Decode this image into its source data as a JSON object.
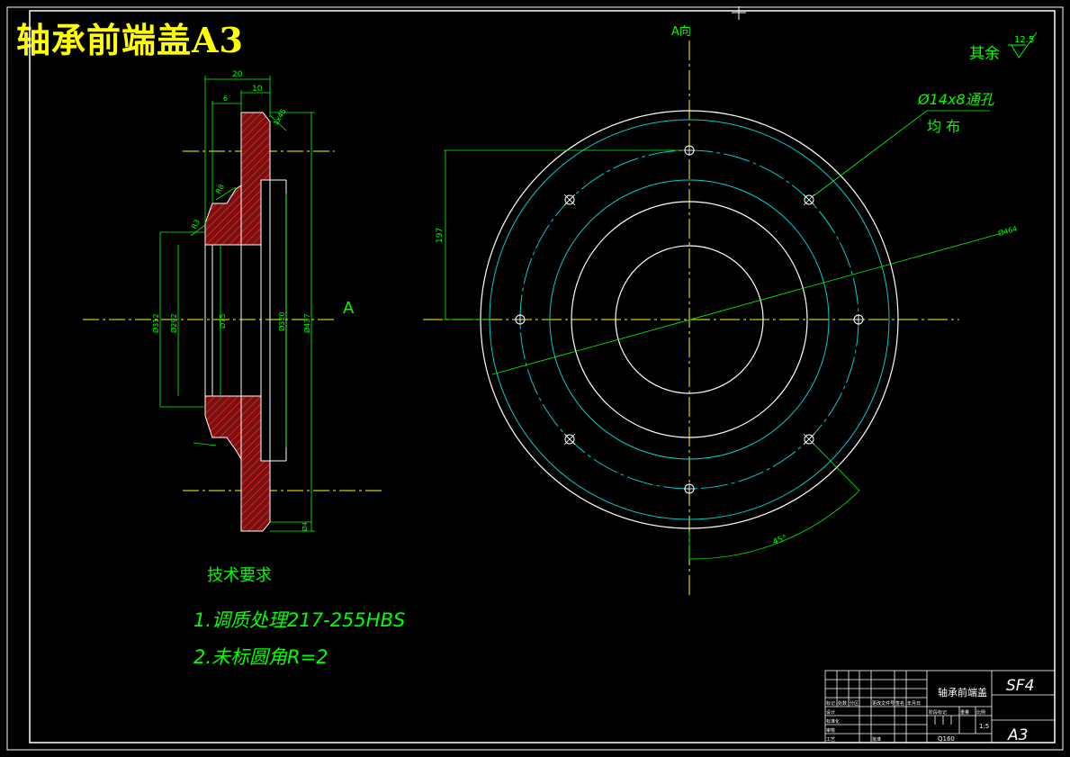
{
  "title": "轴承前端盖A3",
  "view_label": "A",
  "view_label_top": "A向",
  "roughness_note": "其余",
  "roughness_value": "12.5",
  "hole_note_line1": "Ø14x8通孔",
  "hole_note_line2": "均    布",
  "angle_label": "45°",
  "bolt_circle_label": "Ø464",
  "vertical_dim_label": "197",
  "section_dims": {
    "top1": "20",
    "top2": "10",
    "top3": "6",
    "chamfer": "1x45",
    "r1": "R8",
    "r2": "R3",
    "d1": "Ø312",
    "d2": "Ø292",
    "d3": "Ø75",
    "d4": "Ø320",
    "d5": "Ø437",
    "bottom": "Ø4"
  },
  "tech_requirements": {
    "heading": "技术要求",
    "items": [
      "1.调质处理217-255HBS",
      "2.未标圆角R=2"
    ]
  },
  "title_block": {
    "part_name": "轴承前端盖",
    "drawing_no": "SF4",
    "sheet_size": "A3",
    "material": "Q160",
    "scale": "1:5",
    "row_labels": [
      "标记",
      "处数",
      "分区",
      "更改文件号",
      "签名",
      "年月日"
    ],
    "left_labels": [
      "设计",
      "标准化",
      "审核",
      "工艺",
      "批准"
    ],
    "stage_labels": [
      "阶段标记",
      "重量",
      "比例"
    ]
  },
  "colors": {
    "outline": "#ffffff",
    "dimension": "#00ff00",
    "centerline": "#ffff00",
    "hatch": "#cc2222",
    "cyan": "#00cccc",
    "title": "#ffff00"
  }
}
